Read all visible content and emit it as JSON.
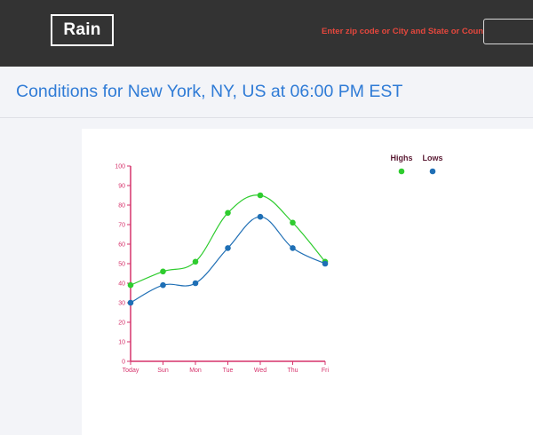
{
  "header": {
    "logo": "Rain",
    "zip_prompt": "Enter zip code or City and State or Country",
    "zip_placeholder": "",
    "zip_value": ""
  },
  "conditions": {
    "title": "Conditions for New York, NY, US at 06:00 PM EST"
  },
  "colors": {
    "highs": "#2ecc2e",
    "lows": "#1f6fb5",
    "axis": "#d6336c",
    "title": "#2f7bd6",
    "zip_prompt": "#e5473d"
  },
  "chart_data": {
    "type": "line",
    "categories": [
      "Today",
      "Sun",
      "Mon",
      "Tue",
      "Wed",
      "Thu",
      "Fri"
    ],
    "series": [
      {
        "name": "Highs",
        "values": [
          39,
          46,
          51,
          76,
          85,
          71,
          51
        ]
      },
      {
        "name": "Lows",
        "values": [
          30,
          39,
          40,
          58,
          74,
          58,
          50
        ]
      }
    ],
    "y_ticks": [
      "0",
      "10",
      "20",
      "30",
      "40",
      "50",
      "60",
      "70",
      "80",
      "90",
      "100"
    ],
    "ylim": [
      0,
      100
    ],
    "legend_position": "top-right",
    "grid": false
  }
}
